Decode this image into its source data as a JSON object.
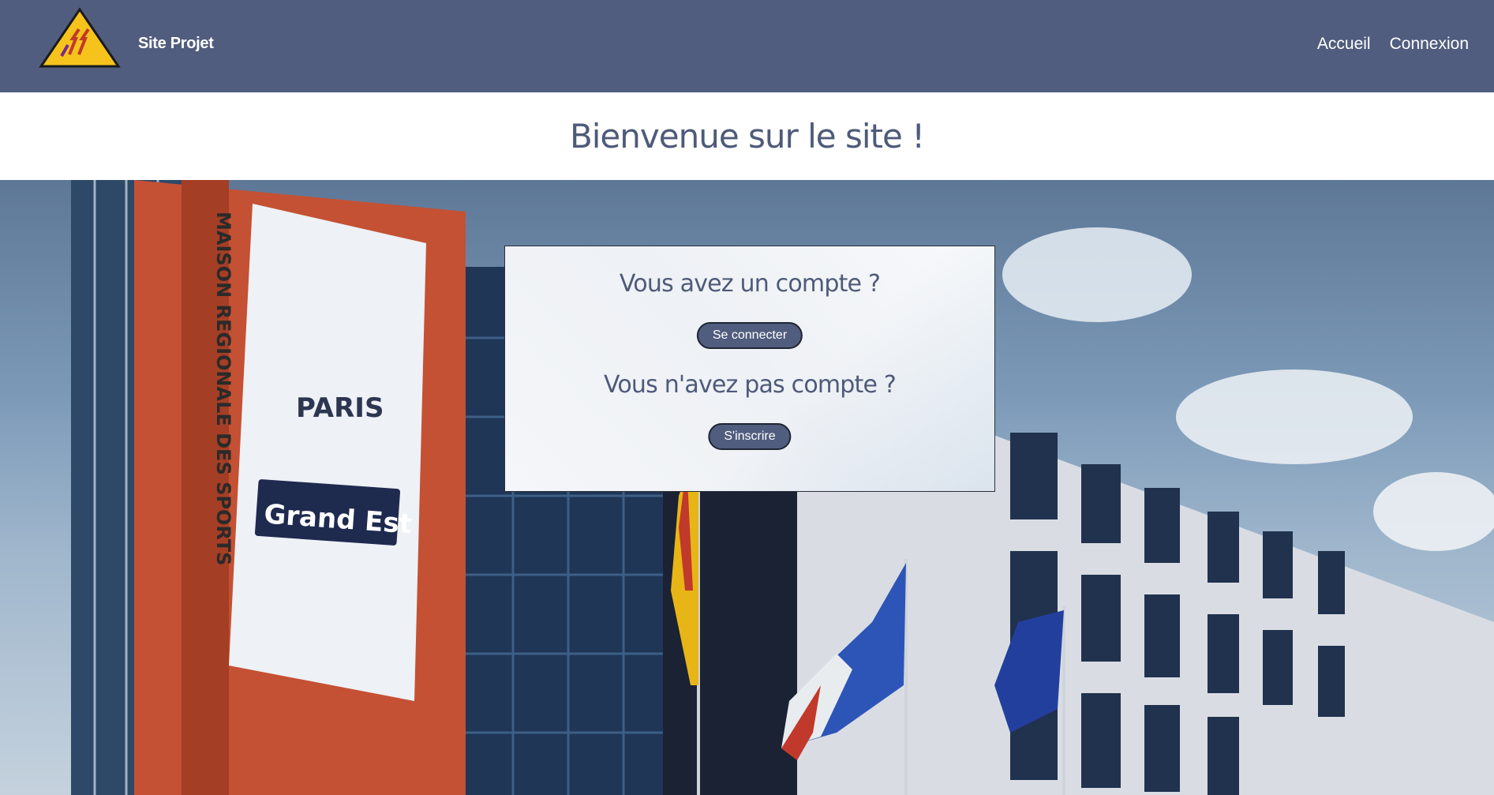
{
  "navbar": {
    "brand": "Site Projet",
    "links": [
      "Accueil",
      "Connexion"
    ],
    "logo_icon": "triangle-warning-logo-icon"
  },
  "welcome": {
    "title": "Bienvenue sur le site !"
  },
  "hero": {
    "building_sign": "MAISON REGIONALE DES SPORTS",
    "banner_paris": "PARIS",
    "banner_grandest": "Grand Est"
  },
  "card": {
    "question_account": "Vous avez un compte ?",
    "login_label": "Se connecter",
    "question_no_account": "Vous n'avez pas compte ?",
    "signup_label": "S'inscrire"
  },
  "colors": {
    "navbar": "#505d7e",
    "title": "#4e5a79",
    "button": "#505d7e"
  }
}
